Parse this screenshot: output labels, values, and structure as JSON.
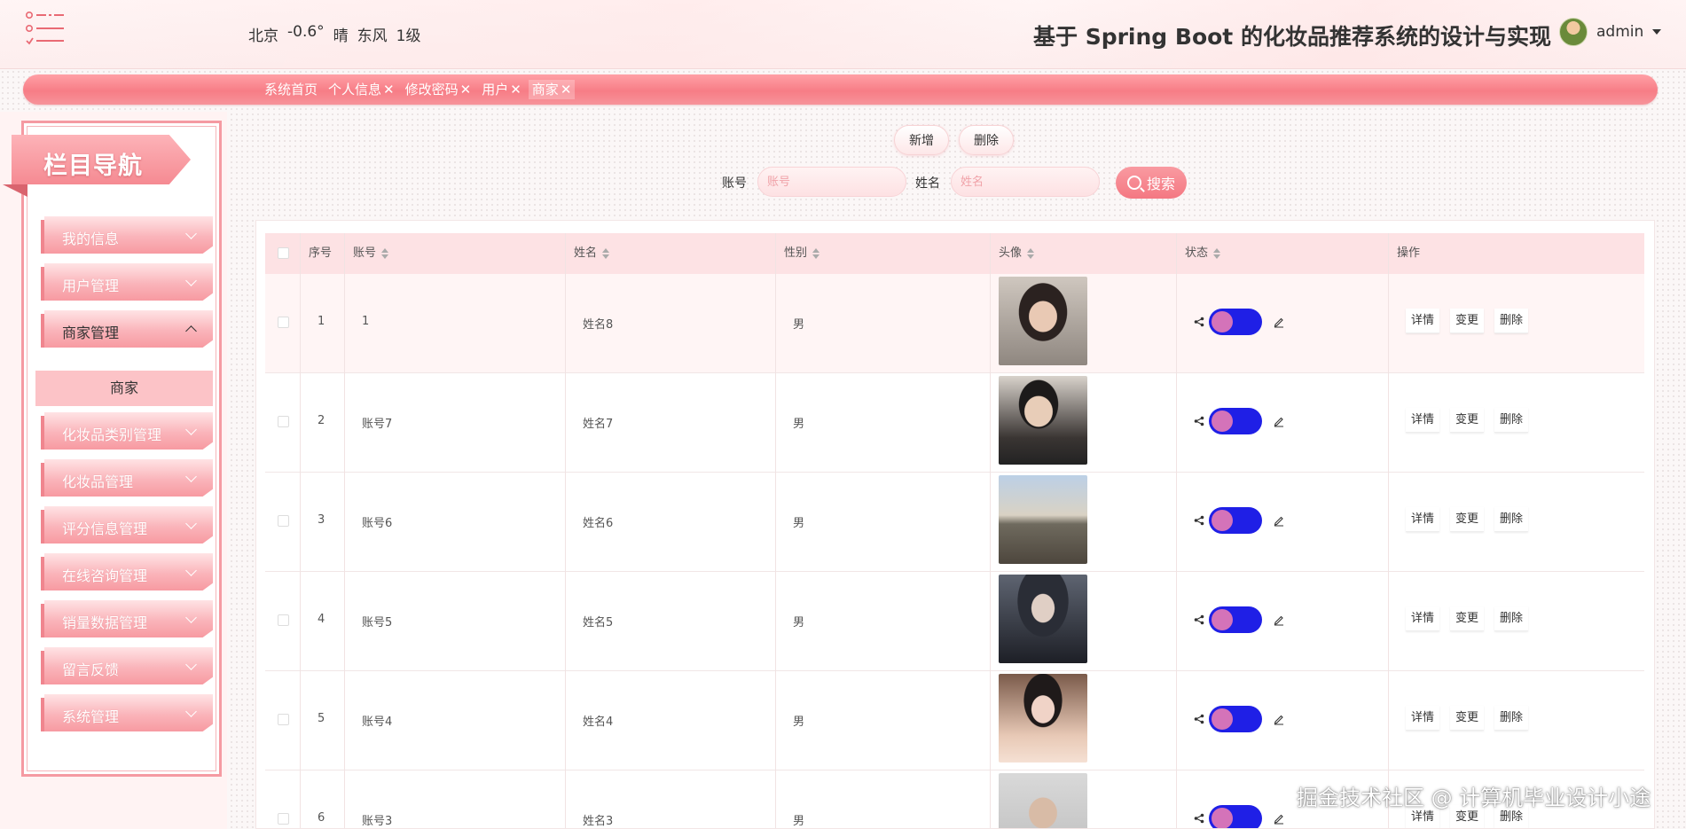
{
  "header": {
    "weather": {
      "city": "北京",
      "temp": "-0.6°",
      "condition": "晴",
      "wind": "东风",
      "level": "1级"
    },
    "title": "基于 Spring Boot 的化妆品推荐系统的设计与实现",
    "user": "admin"
  },
  "tabs": [
    {
      "label": "系统首页",
      "closable": false
    },
    {
      "label": "个人信息",
      "closable": true
    },
    {
      "label": "修改密码",
      "closable": true
    },
    {
      "label": "用户",
      "closable": true
    },
    {
      "label": "商家",
      "closable": true,
      "active": true
    }
  ],
  "tab_close": "✕",
  "sidebar": {
    "title": "栏目导航",
    "items": [
      {
        "label": "我的信息"
      },
      {
        "label": "用户管理"
      },
      {
        "label": "商家管理",
        "open": true
      },
      {
        "label": "化妆品类别管理"
      },
      {
        "label": "化妆品管理"
      },
      {
        "label": "评分信息管理"
      },
      {
        "label": "在线咨询管理"
      },
      {
        "label": "销量数据管理"
      },
      {
        "label": "留言反馈"
      },
      {
        "label": "系统管理"
      }
    ],
    "submenu": {
      "label": "商家"
    }
  },
  "toolbar": {
    "add_label": "新增",
    "delete_label": "删除",
    "account_label": "账号",
    "account_placeholder": "账号",
    "name_label": "姓名",
    "name_placeholder": "姓名",
    "search_label": "搜索"
  },
  "table": {
    "columns": [
      "序号",
      "账号",
      "姓名",
      "性别",
      "头像",
      "状态",
      "操作"
    ],
    "rows": [
      {
        "index": "1",
        "account": "1",
        "name": "姓名8",
        "gender": "男"
      },
      {
        "index": "2",
        "account": "账号7",
        "name": "姓名7",
        "gender": "男"
      },
      {
        "index": "3",
        "account": "账号6",
        "name": "姓名6",
        "gender": "男"
      },
      {
        "index": "4",
        "account": "账号5",
        "name": "姓名5",
        "gender": "男"
      },
      {
        "index": "5",
        "account": "账号4",
        "name": "姓名4",
        "gender": "男"
      },
      {
        "index": "6",
        "account": "账号3",
        "name": "姓名3",
        "gender": "男"
      }
    ],
    "ops": {
      "detail": "详情",
      "change": "变更",
      "delete": "删除"
    }
  },
  "watermark": "掘金技术社区 @ 计算机毕业设计小途",
  "colors": {
    "accent": "#f77d86",
    "toggle_track": "#1f1fe6",
    "toggle_knob": "#d473b9"
  }
}
